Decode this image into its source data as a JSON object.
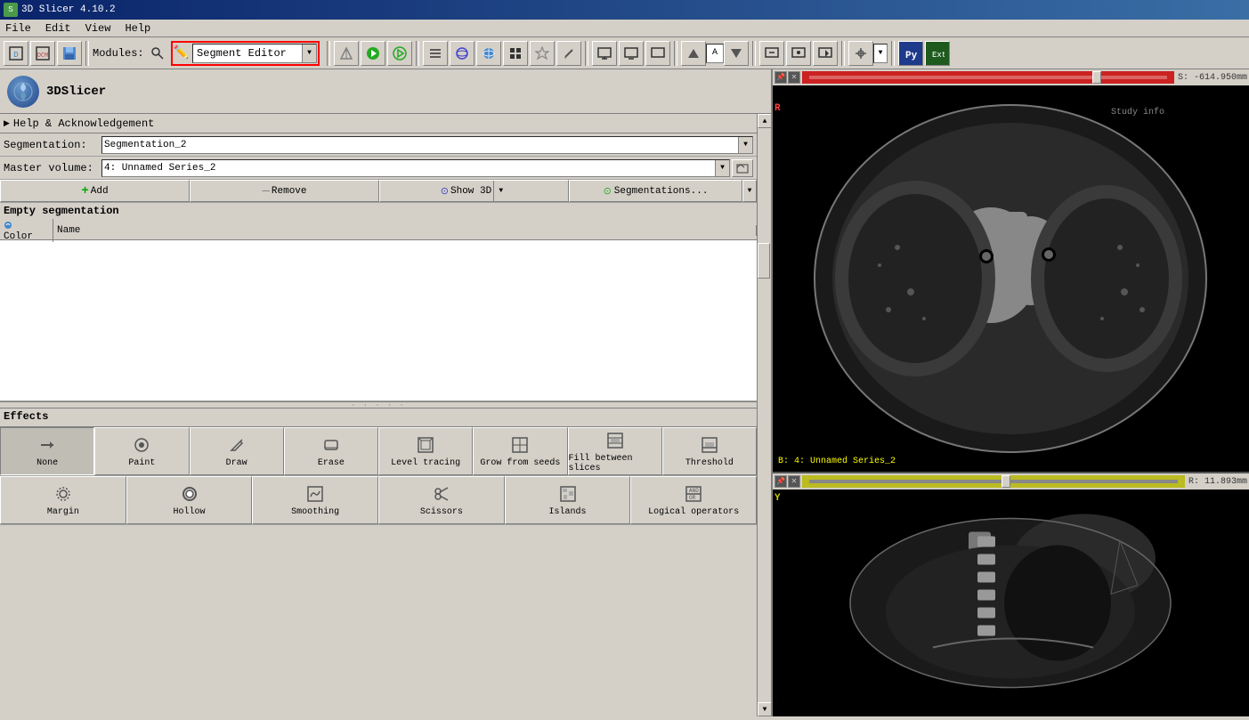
{
  "titleBar": {
    "appName": "3D Slicer 4.10.2",
    "iconLabel": "S"
  },
  "menuBar": {
    "items": [
      "File",
      "Edit",
      "View",
      "Help"
    ]
  },
  "toolbar": {
    "modulesLabel": "Modules:",
    "moduleSelector": "Segment Editor",
    "buttons": [
      "data",
      "dcm",
      "save",
      "back",
      "forward",
      "list",
      "3d-sphere",
      "globe",
      "grid",
      "star",
      "pen",
      "monitor",
      "monitor2",
      "monitor3"
    ]
  },
  "leftPanel": {
    "helpSection": "Help & Acknowledgement",
    "segmentation": {
      "label": "Segmentation:",
      "value": "Segmentation_2"
    },
    "masterVolume": {
      "label": "Master volume:",
      "value": "4: Unnamed Series_2"
    },
    "buttons": {
      "add": "+ Add",
      "remove": "— Remove",
      "show3d": "⊙  Show 3D",
      "segmentations": "⊙ Segmentations..."
    },
    "segTableHeader": {
      "color": "Color",
      "name": "Name"
    },
    "emptySegLabel": "Empty segmentation",
    "effectsLabel": "Effects",
    "effects": [
      {
        "id": "none",
        "label": "None",
        "icon": "→"
      },
      {
        "id": "paint",
        "label": "Paint",
        "icon": "🖌"
      },
      {
        "id": "draw",
        "label": "Draw",
        "icon": "✏"
      },
      {
        "id": "erase",
        "label": "Erase",
        "icon": "⬜"
      },
      {
        "id": "level-tracing",
        "label": "Level tracing",
        "icon": "⊞"
      },
      {
        "id": "grow-from-seeds",
        "label": "Grow from seeds",
        "icon": "⊞"
      },
      {
        "id": "fill-between-slices",
        "label": "Fill between slices",
        "icon": "⊞"
      },
      {
        "id": "threshold",
        "label": "Threshold",
        "icon": "⊟"
      },
      {
        "id": "margin",
        "label": "Margin",
        "icon": "⊙"
      },
      {
        "id": "hollow",
        "label": "Hollow",
        "icon": "◎"
      },
      {
        "id": "smoothing",
        "label": "Smoothing",
        "icon": "⊡"
      },
      {
        "id": "scissors",
        "label": "Scissors",
        "icon": "✂"
      },
      {
        "id": "islands",
        "label": "Islands",
        "icon": "⊞"
      },
      {
        "id": "logical-operators",
        "label": "Logical operators",
        "icon": "⊟"
      }
    ]
  },
  "rightPanel": {
    "topViewer": {
      "orientation": "R",
      "sliceCoord": "S: -614.950mm",
      "sliderPercent": 78,
      "bottomLabel": "B: 4: Unnamed Series_2"
    },
    "bottomViewer": {
      "orientation": "Y",
      "sliceCoord": "R: 11.893mm",
      "sliderPercent": 52
    }
  }
}
